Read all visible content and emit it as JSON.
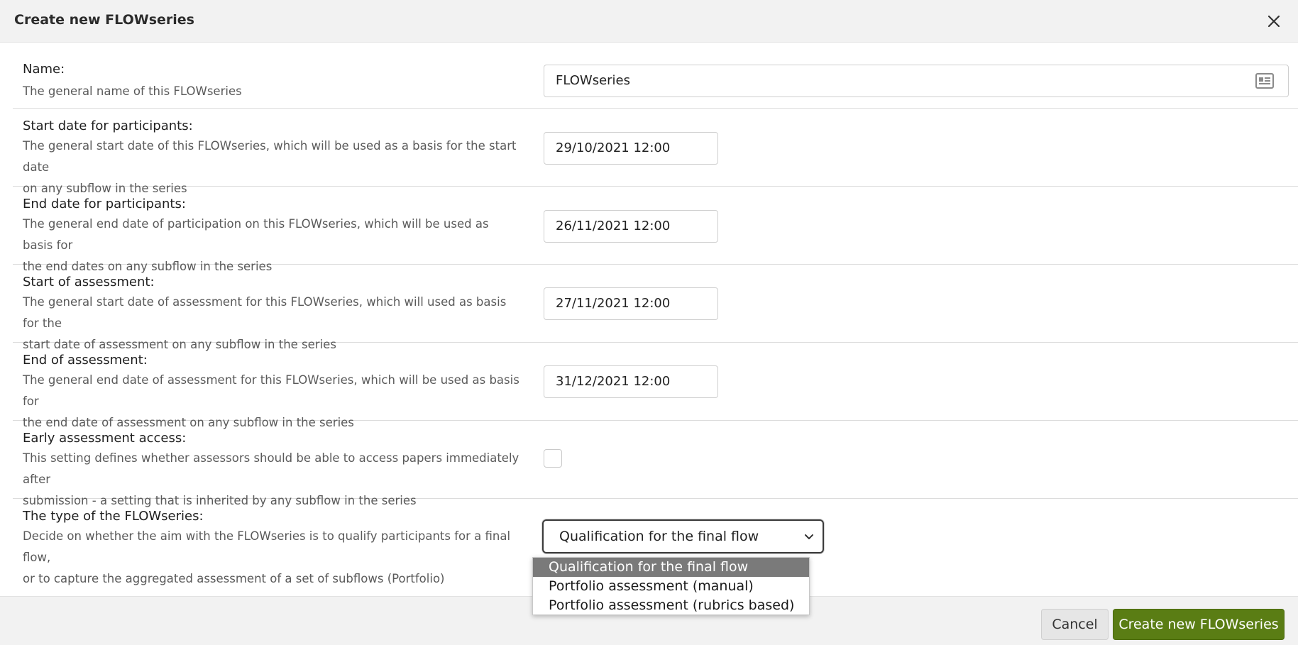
{
  "header": {
    "title": "Create new FLOWseries"
  },
  "fields": {
    "name": {
      "label": "Name:",
      "description": "The general name of this FLOWseries",
      "value": "FLOWseries"
    },
    "start_date": {
      "label": "Start date for participants:",
      "description_1": "The general start date of this FLOWseries, which will be used as a basis for the start date",
      "description_2": "on any subflow in the series",
      "value": "29/10/2021 12:00"
    },
    "end_date": {
      "label": "End date for participants:",
      "description_1": "The general end date of participation on this FLOWseries, which will be used as basis for",
      "description_2": "the end dates on any subflow in the series",
      "value": "26/11/2021 12:00"
    },
    "start_assessment": {
      "label": "Start of assessment:",
      "description_1": "The general start date of assessment for this FLOWseries, which will used as basis for the",
      "description_2": "start date of assessment on any subflow in the series",
      "value": "27/11/2021 12:00"
    },
    "end_assessment": {
      "label": "End of assessment:",
      "description_1": "The general end date of assessment for this FLOWseries, which will be used as basis for",
      "description_2": "the end date of assessment on any subflow in the series",
      "value": "31/12/2021 12:00"
    },
    "early_access": {
      "label": "Early assessment access:",
      "description_1": "This setting defines whether assessors should be able to access papers immediately after",
      "description_2": "submission - a setting that is inherited by any subflow in the series",
      "checked": false
    },
    "series_type": {
      "label": "The type of the FLOWseries:",
      "description_1": "Decide on whether the aim with the FLOWseries is to qualify participants for a final flow,",
      "description_2": "or to capture the aggregated assessment of a set of subflows (Portfolio)",
      "selected": "Qualification for the final flow",
      "options": [
        "Qualification for the final flow",
        "Portfolio assessment (manual)",
        "Portfolio assessment (rubrics based)"
      ]
    }
  },
  "footer": {
    "cancel_label": "Cancel",
    "create_label": "Create new FLOWseries"
  },
  "colors": {
    "primary_button": "#5a7d14",
    "selected_option": "#7a7a7a",
    "header_bg": "#f2f2f2"
  },
  "icons": {
    "close": "close-icon",
    "contact_card": "contact-card-icon",
    "chevron": "chevron-down-icon"
  }
}
